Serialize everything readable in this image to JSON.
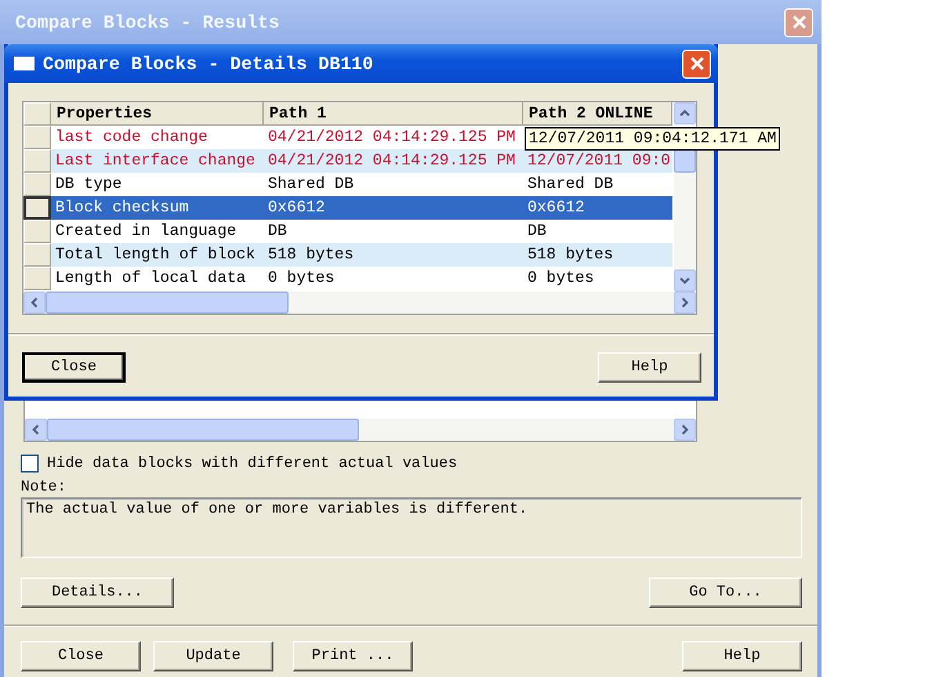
{
  "window": {
    "title": "Compare Blocks - Results"
  },
  "details_dialog": {
    "title": "Compare Blocks - Details DB110",
    "columns": [
      "Properties",
      "Path 1",
      "Path 2 ONLINE"
    ],
    "rows": [
      {
        "property": "last code change",
        "path_1": "04/21/2012 04:14:29.125 PM",
        "path_2": "12/07/2011 09:04:12.171 AM",
        "differs": true,
        "selected": false,
        "tooltip": true
      },
      {
        "property": "Last interface change",
        "path_1": "04/21/2012 04:14:29.125 PM",
        "path_2": "12/07/2011 09:0",
        "differs": true,
        "selected": false,
        "tooltip": false
      },
      {
        "property": "DB type",
        "path_1": "Shared DB",
        "path_2": "Shared DB",
        "differs": false,
        "selected": false,
        "tooltip": false
      },
      {
        "property": "Block checksum",
        "path_1": "0x6612",
        "path_2": "0x6612",
        "differs": false,
        "selected": true,
        "tooltip": false
      },
      {
        "property": "Created in language",
        "path_1": "DB",
        "path_2": "DB",
        "differs": false,
        "selected": false,
        "tooltip": false
      },
      {
        "property": "Total length of block",
        "path_1": "518 bytes",
        "path_2": "518 bytes",
        "differs": false,
        "selected": false,
        "tooltip": false
      },
      {
        "property": "Length of local data",
        "path_1": "0 bytes",
        "path_2": "0 bytes",
        "differs": false,
        "selected": false,
        "tooltip": false
      }
    ],
    "buttons": [
      {
        "label": "Close",
        "default": true
      },
      {
        "label": "Help",
        "default": false
      }
    ]
  },
  "hide_checkbox": {
    "label": "Hide data blocks with different actual values",
    "checked": false
  },
  "note": {
    "label": "Note:",
    "text": "The actual value of one or more variables is different."
  },
  "action_buttons": [
    {
      "label": "Details..."
    },
    {
      "label": "Go To..."
    }
  ],
  "buttons": [
    {
      "label": "Close"
    },
    {
      "label": "Update"
    },
    {
      "label": "Print ..."
    },
    {
      "label": "Help"
    }
  ]
}
